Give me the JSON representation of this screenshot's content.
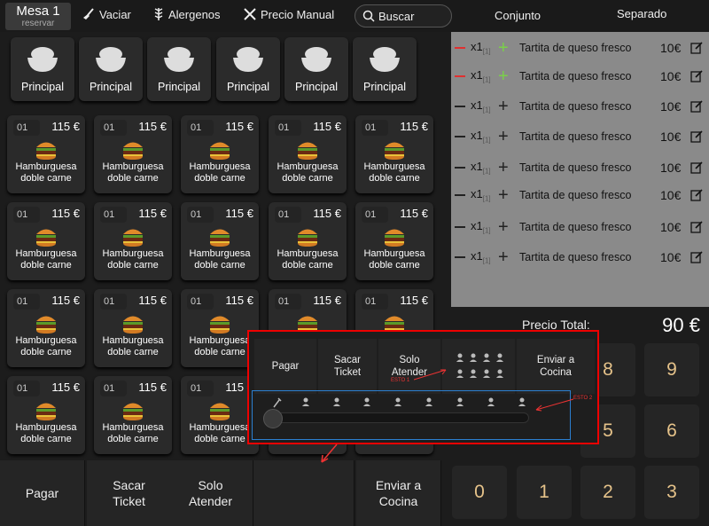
{
  "header": {
    "mesa_title": "Mesa 1",
    "mesa_sub": "reservar",
    "vaciar": "Vaciar",
    "alergenos": "Alergenos",
    "precio_manual": "Precio Manual",
    "buscar": "Buscar"
  },
  "tabs": {
    "conjunto": "Conjunto",
    "separado": "Separado"
  },
  "categories": [
    "Principal",
    "Principal",
    "Principal",
    "Principal",
    "Principal",
    "Principal"
  ],
  "product": {
    "code": "01",
    "price": "115 €",
    "name_line1": "Hamburguesa",
    "name_line2": "doble carne"
  },
  "order_lines": [
    {
      "qty": "x1",
      "sub": "[1]",
      "name": "Tartita de queso fresco",
      "price": "10€",
      "mark": "red",
      "plus": "green"
    },
    {
      "qty": "x1",
      "sub": "[1]",
      "name": "Tartita de queso fresco",
      "price": "10€",
      "mark": "red",
      "plus": "green"
    },
    {
      "qty": "x1",
      "sub": "[1]",
      "name": "Tartita de queso fresco",
      "price": "10€",
      "mark": "grey",
      "plus": "grey"
    },
    {
      "qty": "x1",
      "sub": "[1]",
      "name": "Tartita de queso fresco",
      "price": "10€",
      "mark": "grey",
      "plus": "grey"
    },
    {
      "qty": "x1",
      "sub": "[1]",
      "name": "Tartita de queso fresco",
      "price": "10€",
      "mark": "grey",
      "plus": "grey"
    },
    {
      "qty": "x1",
      "sub": "[1]",
      "name": "Tartita de queso fresco",
      "price": "10€",
      "mark": "grey",
      "plus": "grey"
    },
    {
      "qty": "x1",
      "sub": "[1]",
      "name": "Tartita de queso fresco",
      "price": "10€",
      "mark": "grey",
      "plus": "grey"
    },
    {
      "qty": "x1",
      "sub": "[1]",
      "name": "Tartita de queso fresco",
      "price": "10€",
      "mark": "grey",
      "plus": "grey"
    }
  ],
  "total": {
    "label": "Precio Total:",
    "value": "90 €"
  },
  "keypad": {
    "k8": "8",
    "k9": "9",
    "k5": "5",
    "k6": "6",
    "k0": "0",
    "k1": "1",
    "k2": "2",
    "k3": "3"
  },
  "actions": {
    "pagar": "Pagar",
    "sacar1": "Sacar",
    "sacar2": "Ticket",
    "solo1": "Solo",
    "solo2": "Atender",
    "enviar1": "Enviar a",
    "enviar2": "Cocina",
    "doble": "doble carne"
  },
  "popup": {
    "pagar": "Pagar",
    "sacar1": "Sacar",
    "sacar2": "Ticket",
    "solo1": "Solo",
    "solo2": "Atender",
    "enviar1": "Enviar a",
    "enviar2": "Cocina",
    "esto1": "ESTO 1",
    "esto2": "ESTO 2"
  },
  "colors": {
    "accent_red": "#e03030",
    "accent_green": "#7ad04a",
    "key_digit": "#e6c38a",
    "highlight_blue": "#2c7fd0"
  }
}
